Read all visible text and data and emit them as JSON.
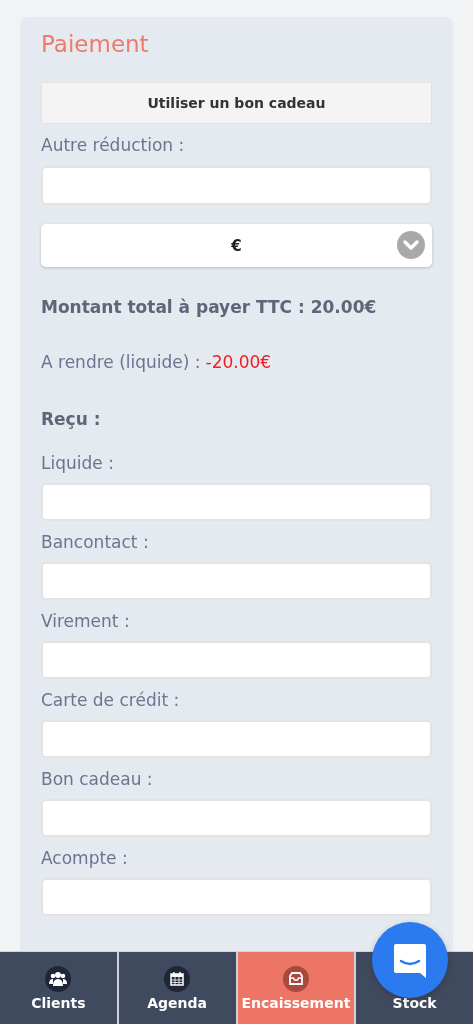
{
  "title": "Paiement",
  "gift_button": "Utiliser un bon cadeau",
  "discount": {
    "label": "Autre réduction :",
    "unit": "€"
  },
  "total": "Montant total à payer TTC : 20.00€",
  "change": {
    "label": "A rendre (liquide) :",
    "value": "-20.00€"
  },
  "received_heading": "Reçu :",
  "fields": [
    {
      "label": "Liquide :"
    },
    {
      "label": "Bancontact :"
    },
    {
      "label": "Virement :"
    },
    {
      "label": "Carte de crédit :"
    },
    {
      "label": "Bon cadeau :"
    },
    {
      "label": "Acompte :"
    }
  ],
  "nav": [
    {
      "label": "Clients",
      "kind": "people",
      "selected": false
    },
    {
      "label": "Agenda",
      "kind": "calendar",
      "selected": false
    },
    {
      "label": "Encaissement",
      "kind": "inbox",
      "selected": true
    },
    {
      "label": "Stock",
      "kind": "hidden",
      "selected": false
    }
  ]
}
